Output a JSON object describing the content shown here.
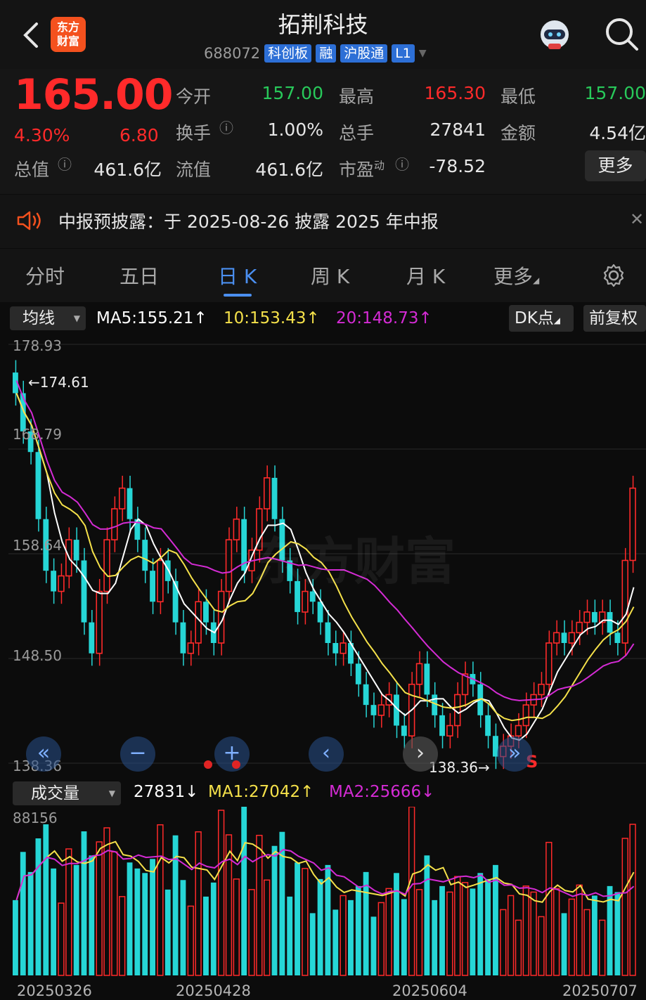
{
  "nav": {
    "logo_line1": "东方",
    "logo_line2": "财富",
    "title": "拓荆科技",
    "code": "688072",
    "tags": [
      "科创板",
      "融",
      "沪股通",
      "L1"
    ]
  },
  "quote": {
    "price": "165.00",
    "change_pct": "4.30%",
    "change_abs": "6.80",
    "fields": {
      "open_label": "今开",
      "open": "157.00",
      "high_label": "最高",
      "high": "165.30",
      "low_label": "最低",
      "low": "157.00",
      "turnover_label": "换手",
      "turnover": "1.00%",
      "volume_label": "总手",
      "volume": "27841",
      "amount_label": "金额",
      "amount": "4.54亿",
      "mcap_label": "总值",
      "mcap": "461.6亿",
      "float_label": "流值",
      "float": "461.6亿",
      "pe_label": "市盈",
      "pe_sup": "动",
      "pe": "-78.52"
    },
    "more_label": "更多"
  },
  "notice": {
    "text": "中报预披露：于 2025-08-26 披露 2025 年中报"
  },
  "tabs": [
    "分时",
    "五日",
    "日 K",
    "周 K",
    "月 K",
    "更多"
  ],
  "active_tab": "日 K",
  "ma_bar": {
    "dropdown": "均线",
    "ma5": "MA5:155.21↑",
    "ma10": "10:153.43↑",
    "ma20": "20:148.73↑",
    "dk_label": "DK点",
    "adjust_label": "前复权"
  },
  "kline_axis": {
    "labels": [
      "178.93",
      "168.79",
      "158.64",
      "148.50",
      "138.36"
    ],
    "max_marker": "←174.61",
    "min_marker": "138.36→",
    "signal": "S"
  },
  "volume_bar": {
    "dropdown": "成交量",
    "vol": "27831↓",
    "ma1": "MA1:27042↑",
    "ma2": "MA2:25666↓",
    "axis_max": "88156"
  },
  "dates": [
    "20250326",
    "20250428",
    "20250604",
    "20250707"
  ],
  "colors": {
    "up": "#ff2a2a",
    "down": "#26d6d6",
    "ma5": "#ffffff",
    "ma10": "#f5e14a",
    "ma20": "#d42bd4",
    "accent": "#4b8ff0"
  },
  "chart_data": {
    "type": "candlestick",
    "y_range": [
      138.36,
      178.93
    ],
    "ma_lines": [
      "MA5",
      "MA10",
      "MA20"
    ],
    "closes": [
      174.2,
      170.5,
      168.5,
      162.0,
      157.0,
      155.0,
      156.5,
      160.0,
      158.0,
      152.0,
      149.0,
      155.0,
      160.0,
      163.0,
      165.0,
      162.0,
      160.0,
      157.0,
      154.0,
      158.0,
      156.0,
      152.0,
      149.0,
      150.0,
      154.0,
      152.0,
      150.0,
      155.0,
      160.0,
      162.0,
      157.0,
      159.0,
      163.0,
      166.0,
      162.0,
      158.0,
      156.0,
      153.0,
      155.0,
      154.0,
      152.0,
      150.0,
      149.0,
      150.0,
      148.0,
      146.0,
      144.0,
      143.0,
      144.0,
      145.0,
      142.0,
      141.0,
      146.0,
      148.0,
      145.0,
      143.0,
      141.0,
      142.0,
      145.0,
      147.0,
      146.0,
      143.0,
      141.0,
      139.0,
      140.0,
      141.0,
      142.0,
      144.0,
      145.0,
      146.0,
      150.0,
      151.0,
      150.0,
      151.0,
      152.0,
      153.0,
      152.0,
      153.0,
      151.0,
      150.0,
      158.0,
      165.0
    ]
  }
}
